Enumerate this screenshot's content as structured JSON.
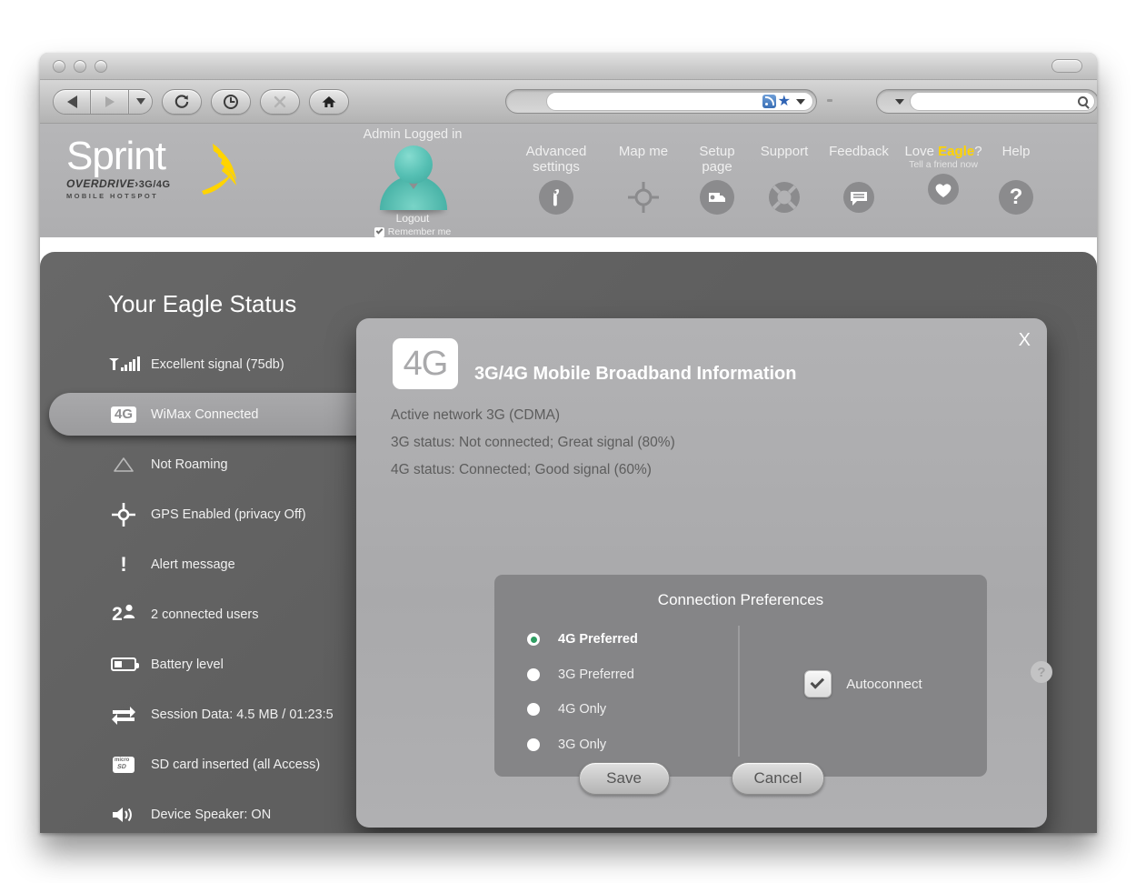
{
  "browser": {
    "toolbar": {
      "back": "back-button",
      "forward": "forward-button",
      "history_dropdown": "history-dropdown",
      "reload": "reload-button",
      "clock": "history-clock-button",
      "stop": "stop-button",
      "home": "home-button",
      "address_value": "",
      "address_placeholder": "",
      "search_value": "",
      "search_placeholder": ""
    }
  },
  "header": {
    "logo": {
      "word": "Sprint",
      "sub": "OVERDRIVE",
      "sub_suffix": "3G/4G",
      "sub2": "MOBILE HOTSPOT"
    },
    "admin": {
      "status": "Admin Logged in",
      "logout": "Logout",
      "remember": "Remember me",
      "remember_checked": true
    },
    "nav": [
      {
        "label": "Advanced",
        "label2": "settings",
        "sub": "",
        "icon": "wrench-icon"
      },
      {
        "label": "Map me",
        "label2": "",
        "sub": "",
        "icon": "crosshair-icon"
      },
      {
        "label": "Setup",
        "label2": "page",
        "sub": "",
        "icon": "setup-icon"
      },
      {
        "label": "Support",
        "label2": "",
        "sub": "",
        "icon": "lifering-icon"
      },
      {
        "label": "Feedback",
        "label2": "",
        "sub": "",
        "icon": "speech-bubble-icon"
      },
      {
        "label": "Love ",
        "brand": "Eagle",
        "label_tail": "?",
        "label2": "",
        "sub": "Tell a friend now",
        "icon": "heart-icon"
      },
      {
        "label": "Help",
        "label2": "",
        "sub": "",
        "icon": "question-icon"
      }
    ]
  },
  "page": {
    "title": "Your Eagle Status",
    "status_items": [
      {
        "icon": "signal-bars-icon",
        "text": "Excellent signal (75db)",
        "active": false
      },
      {
        "icon": "4g-badge-icon",
        "text": "WiMax Connected",
        "active": true
      },
      {
        "icon": "roaming-triangle-icon",
        "text": "Not Roaming",
        "active": false
      },
      {
        "icon": "gps-crosshair-icon",
        "text": "GPS Enabled (privacy Off)",
        "active": false
      },
      {
        "icon": "alert-exclamation-icon",
        "text": "Alert message",
        "active": false
      },
      {
        "icon": "users-icon",
        "text": "2 connected users",
        "active": false
      },
      {
        "icon": "battery-icon",
        "text": "Battery level",
        "active": false
      },
      {
        "icon": "data-transfer-icon",
        "text": "Session Data:  4.5 MB / 01:23:5",
        "active": false
      },
      {
        "icon": "microsd-icon",
        "text": "SD card inserted (all Access)",
        "active": false
      },
      {
        "icon": "speaker-icon",
        "text": "Device Speaker: ON",
        "active": false
      }
    ]
  },
  "dialog": {
    "close_label": "X",
    "badge": "4G",
    "title": "3G/4G Mobile Broadband Information",
    "lines": [
      "Active network 3G (CDMA)",
      "3G status: Not connected; Great signal (80%)",
      "4G status: Connected; Good signal (60%)"
    ],
    "prefs_title": "Connection Preferences",
    "options": [
      {
        "label": "4G Preferred",
        "selected": true
      },
      {
        "label": "3G Preferred",
        "selected": false
      },
      {
        "label": "4G Only",
        "selected": false
      },
      {
        "label": "3G Only",
        "selected": false
      }
    ],
    "autoconnect_label": "Autoconnect",
    "autoconnect_checked": true,
    "help_glyph": "?",
    "save_label": "Save",
    "cancel_label": "Cancel"
  },
  "colors": {
    "brand_yellow": "#ffd400",
    "accent_teal": "#4fb5a8",
    "radio_green": "#2f9e63",
    "panel_dark": "#606060",
    "header_gray": "#b2b2b4"
  }
}
